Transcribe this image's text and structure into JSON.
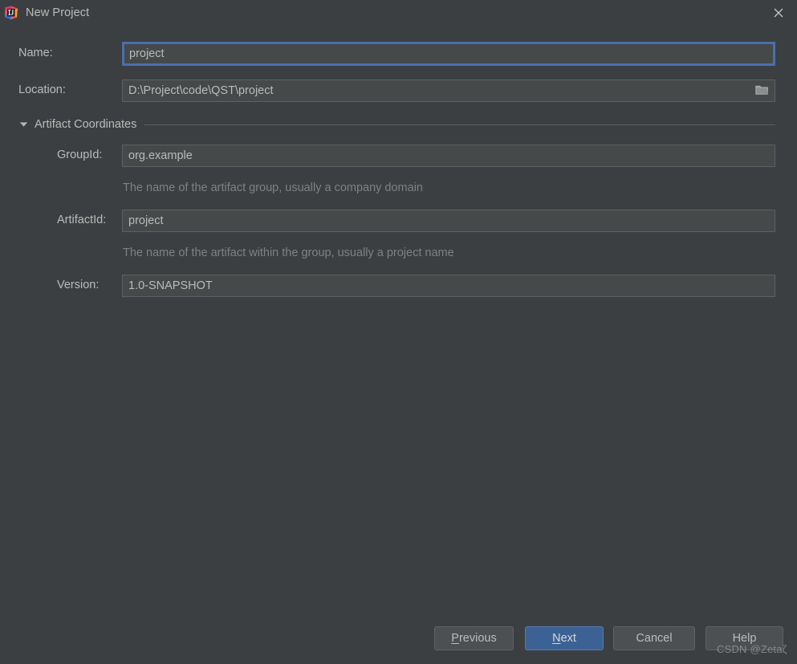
{
  "window": {
    "title": "New Project",
    "app_icon": "intellij-idea-icon",
    "close_icon": "close-icon",
    "background_color": "#3c3f41",
    "text_color": "#bbbbbb"
  },
  "form": {
    "name": {
      "label": "Name:",
      "value": "project",
      "placeholder": "",
      "focused": true
    },
    "location": {
      "label": "Location:",
      "value": "D:\\Project\\code\\QST\\project",
      "placeholder": "",
      "browse_icon": "folder-icon"
    },
    "artifact_section": {
      "label": "Artifact Coordinates",
      "expanded": true,
      "toggle_icon": "chevron-down-icon"
    },
    "group_id": {
      "label": "GroupId:",
      "value": "org.example",
      "hint": "The name of the artifact group, usually a company domain"
    },
    "artifact_id": {
      "label": "ArtifactId:",
      "value": "project",
      "hint": "The name of the artifact within the group, usually a project name"
    },
    "version": {
      "label": "Version:",
      "value": "1.0-SNAPSHOT",
      "hint": ""
    }
  },
  "buttons": {
    "previous": {
      "label": "Previous",
      "mnemonic": "P",
      "primary": false
    },
    "next": {
      "label": "Next",
      "mnemonic": "N",
      "primary": true,
      "accent_color": "#3c6295"
    },
    "cancel": {
      "label": "Cancel",
      "mnemonic": "",
      "primary": false
    },
    "help": {
      "label": "Help",
      "mnemonic": "",
      "primary": false
    }
  },
  "watermark": {
    "text": "CSDN @Zetaζ"
  }
}
